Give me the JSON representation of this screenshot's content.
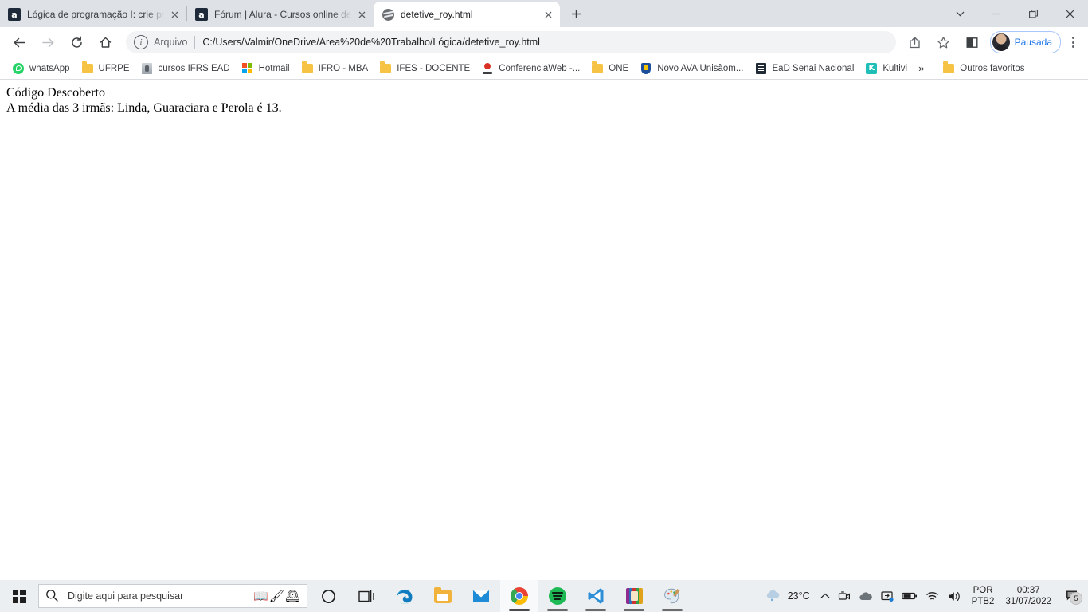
{
  "browser": {
    "tabs": [
      {
        "title": "Lógica de programação I: crie pro",
        "favicon": "alura-icon",
        "active": false
      },
      {
        "title": "Fórum | Alura - Cursos online de",
        "favicon": "alura-icon",
        "active": false
      },
      {
        "title": "detetive_roy.html",
        "favicon": "globe-icon",
        "active": true
      }
    ],
    "new_tab_label": "+",
    "window_controls": {
      "tab_search": "tab-search-chevron-icon",
      "minimize": "minimize-icon",
      "maximize": "restore-icon",
      "close": "close-icon"
    },
    "toolbar": {
      "back": "back-arrow-icon",
      "forward": "forward-arrow-icon",
      "reload": "reload-icon",
      "home": "home-icon",
      "omnibox": {
        "info_glyph": "i",
        "scheme_label": "Arquivo",
        "url": "C:/Users/Valmir/OneDrive/Área%20de%20Trabalho/Lógica/detetive_roy.html"
      },
      "share": "share-icon",
      "bookmark_star": "star-icon",
      "side_panel": "side-panel-icon",
      "profile_label": "Pausada",
      "menu": "kebab-menu-icon"
    },
    "bookmarks": [
      {
        "label": "whatsApp",
        "icon": "whatsapp-icon"
      },
      {
        "label": "UFRPE",
        "icon": "folder-icon"
      },
      {
        "label": "cursos IFRS EAD",
        "icon": "ifrs-icon"
      },
      {
        "label": "Hotmail",
        "icon": "microsoft-icon"
      },
      {
        "label": "IFRO - MBA",
        "icon": "folder-icon"
      },
      {
        "label": "IFES - DOCENTE",
        "icon": "folder-icon"
      },
      {
        "label": "ConferenciaWeb -...",
        "icon": "conferenciaweb-icon"
      },
      {
        "label": "ONE",
        "icon": "folder-icon"
      },
      {
        "label": "Novo AVA Unisãom...",
        "icon": "shield-icon"
      },
      {
        "label": "EaD Senai Nacional",
        "icon": "senai-icon"
      },
      {
        "label": "Kultivi",
        "icon": "kultivi-icon"
      }
    ],
    "bookmarks_overflow": "»",
    "other_bookmarks": {
      "label": "Outros favoritos",
      "icon": "folder-icon"
    }
  },
  "page": {
    "line1": "Código Descoberto",
    "line2": "A média das 3 irmãs: Linda, Guaraciara e Perola é 13."
  },
  "taskbar": {
    "start": "windows-start-icon",
    "search": {
      "placeholder": "Digite aqui para pesquisar",
      "icon": "search-icon"
    },
    "cortana": "cortana-circle-icon",
    "task_view": "task-view-icon",
    "apps": [
      {
        "name": "microsoft-edge",
        "running": false,
        "active": false
      },
      {
        "name": "file-explorer",
        "running": false,
        "active": false
      },
      {
        "name": "mail",
        "running": false,
        "active": false
      },
      {
        "name": "google-chrome",
        "running": true,
        "active": true
      },
      {
        "name": "spotify",
        "running": true,
        "active": false
      },
      {
        "name": "visual-studio-code",
        "running": true,
        "active": false
      },
      {
        "name": "winrar",
        "running": true,
        "active": false
      },
      {
        "name": "paint",
        "running": true,
        "active": false
      }
    ],
    "tray": {
      "weather_temp": "23°C",
      "weather_icon": "rain-cloud-icon",
      "show_hidden": "chevron-up-icon",
      "icons": [
        "camera-icon",
        "onedrive-icon",
        "display-switch-icon",
        "battery-icon",
        "wifi-icon",
        "volume-icon"
      ],
      "language_line1": "POR",
      "language_line2": "PTB2",
      "time": "00:37",
      "date": "31/07/2022",
      "notification_icon": "notification-icon",
      "notification_count": "5"
    }
  },
  "colors": {
    "tabstrip_bg": "#dee1e6",
    "accent_blue": "#1a73e8",
    "taskbar_bg": "#eceff1"
  }
}
